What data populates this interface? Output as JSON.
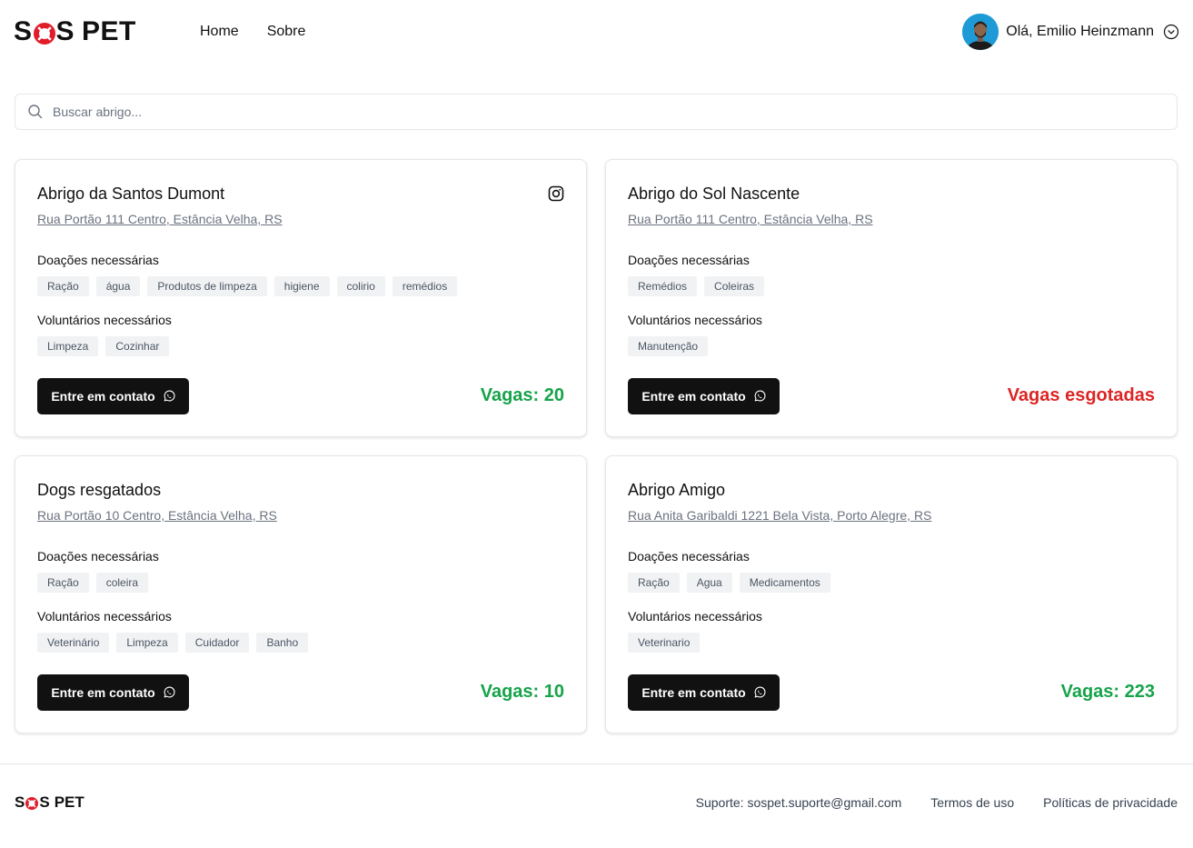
{
  "brand": {
    "logo_left": "S",
    "logo_right": "S",
    "logo_word": "PET"
  },
  "nav": {
    "home": "Home",
    "about": "Sobre"
  },
  "user": {
    "greeting": "Olá, Emilio Heinzmann"
  },
  "search": {
    "placeholder": "Buscar abrigo..."
  },
  "labels": {
    "donations": "Doações necessárias",
    "volunteers": "Voluntários necessários",
    "contact_button": "Entre em contato"
  },
  "shelters": [
    {
      "name": "Abrigo da Santos Dumont",
      "address": "Rua Portão 111 Centro, Estância Velha, RS",
      "has_instagram": true,
      "donations": [
        "Ração",
        "água",
        "Produtos de limpeza",
        "higiene",
        "colirio",
        "remédios"
      ],
      "volunteers": [
        "Limpeza",
        "Cozinhar"
      ],
      "vagas": "Vagas: 20",
      "vagas_color": "#16a34a"
    },
    {
      "name": "Abrigo do Sol Nascente",
      "address": "Rua Portão 111 Centro, Estância Velha, RS",
      "has_instagram": false,
      "donations": [
        "Remédios",
        "Coleiras"
      ],
      "volunteers": [
        "Manutenção"
      ],
      "vagas": "Vagas esgotadas",
      "vagas_color": "#dc2626"
    },
    {
      "name": "Dogs resgatados",
      "address": "Rua Portão 10 Centro, Estância Velha, RS",
      "has_instagram": false,
      "donations": [
        "Ração",
        "coleira"
      ],
      "volunteers": [
        "Veterinário",
        "Limpeza",
        "Cuidador",
        "Banho"
      ],
      "vagas": "Vagas: 10",
      "vagas_color": "#16a34a"
    },
    {
      "name": "Abrigo Amigo",
      "address": "Rua Anita Garibaldi 1221 Bela Vista, Porto Alegre, RS",
      "has_instagram": false,
      "donations": [
        "Ração",
        "Agua",
        "Medicamentos"
      ],
      "volunteers": [
        "Veterinario"
      ],
      "vagas": "Vagas: 223",
      "vagas_color": "#16a34a"
    }
  ],
  "footer": {
    "support": "Suporte: sospet.suporte@gmail.com",
    "terms": "Termos de uso",
    "privacy": "Políticas de privacidade"
  },
  "colors": {
    "accent_red": "#e11d2a",
    "primary": "#111111",
    "available": "#16a34a",
    "full": "#dc2626"
  }
}
